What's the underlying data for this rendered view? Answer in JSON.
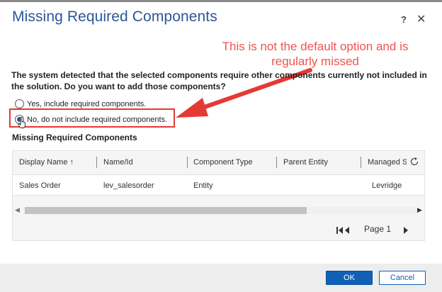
{
  "dialog": {
    "title": "Missing Required Components",
    "help_glyph": "?",
    "close_glyph": "✕"
  },
  "annotation": {
    "line1": "This is not the default option and is",
    "line2": "regularly missed",
    "color": "#ef5350"
  },
  "message": {
    "line1": "The system detected that the selected components require other components currently not included in",
    "line2": "the solution. Do you want to add those components?"
  },
  "options": [
    {
      "label": "Yes, include required components.",
      "selected": false
    },
    {
      "label": "No, do not include required components.",
      "selected": true
    }
  ],
  "section": {
    "title": "Missing Required Components"
  },
  "grid": {
    "columns": [
      "Display Name",
      "Name/Id",
      "Component Type",
      "Parent Entity",
      "Managed S"
    ],
    "sort_indicator": "↑",
    "rows": [
      {
        "display_name": "Sales Order",
        "name_id": "lev_salesorder",
        "component_type": "Entity",
        "parent_entity": "",
        "managed": "Levridge"
      }
    ],
    "pager": {
      "label": "Page 1"
    }
  },
  "buttons": {
    "ok": "OK",
    "cancel": "Cancel"
  },
  "colors": {
    "title": "#2b5797",
    "accent": "#1160b7",
    "highlight": "#e53935"
  }
}
